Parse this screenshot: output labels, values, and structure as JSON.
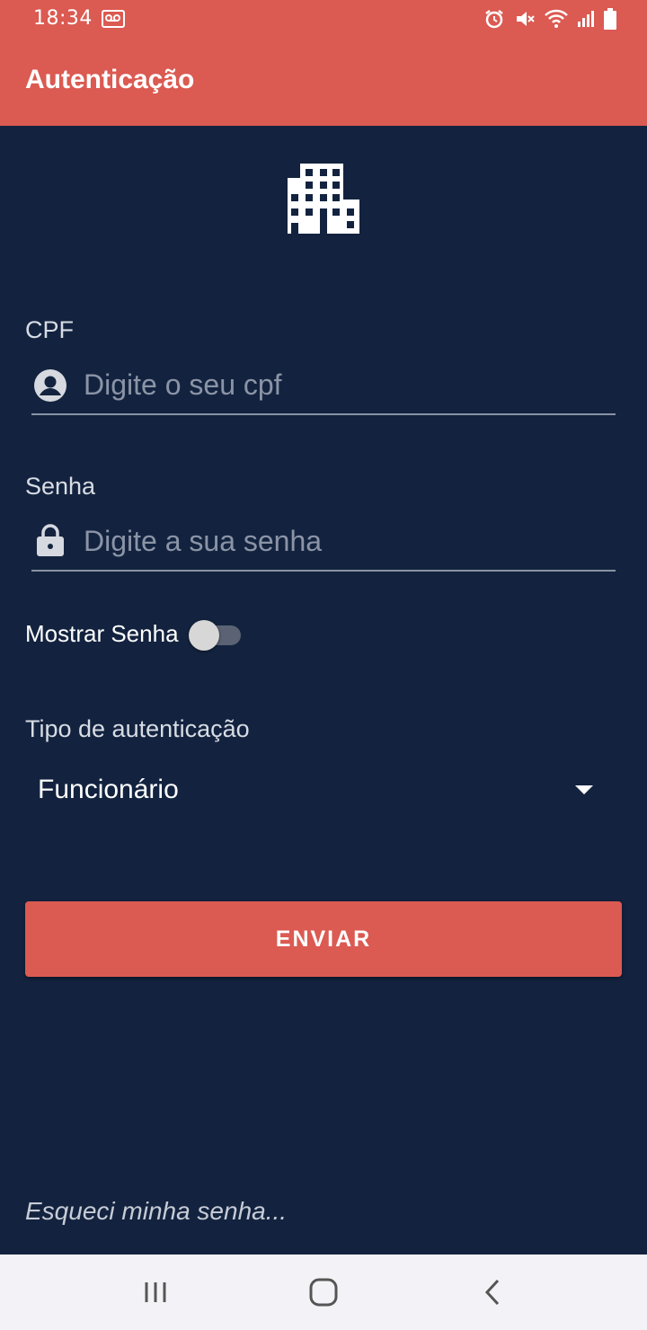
{
  "status_bar": {
    "time": "18:34",
    "icons": [
      "voicemail-icon",
      "alarm-icon",
      "mute-icon",
      "wifi-icon",
      "signal-icon",
      "battery-icon"
    ]
  },
  "app_bar": {
    "title": "Autenticação"
  },
  "logo": {
    "icon": "building-icon"
  },
  "form": {
    "cpf": {
      "label": "CPF",
      "placeholder": "Digite o seu cpf",
      "value": "",
      "icon": "account-circle-icon"
    },
    "senha": {
      "label": "Senha",
      "placeholder": "Digite a sua senha",
      "value": "",
      "icon": "lock-icon"
    },
    "show_password": {
      "label": "Mostrar Senha",
      "checked": false
    },
    "auth_type": {
      "label": "Tipo de autenticação",
      "selected": "Funcionário"
    },
    "submit_label": "ENVIAR",
    "forgot_label": "Esqueci minha senha..."
  },
  "nav_bar": {
    "buttons": [
      "recents-icon",
      "home-icon",
      "back-icon"
    ]
  },
  "colors": {
    "primary": "#db5a52",
    "background": "#13233f",
    "navbar": "#f3f2f6"
  }
}
